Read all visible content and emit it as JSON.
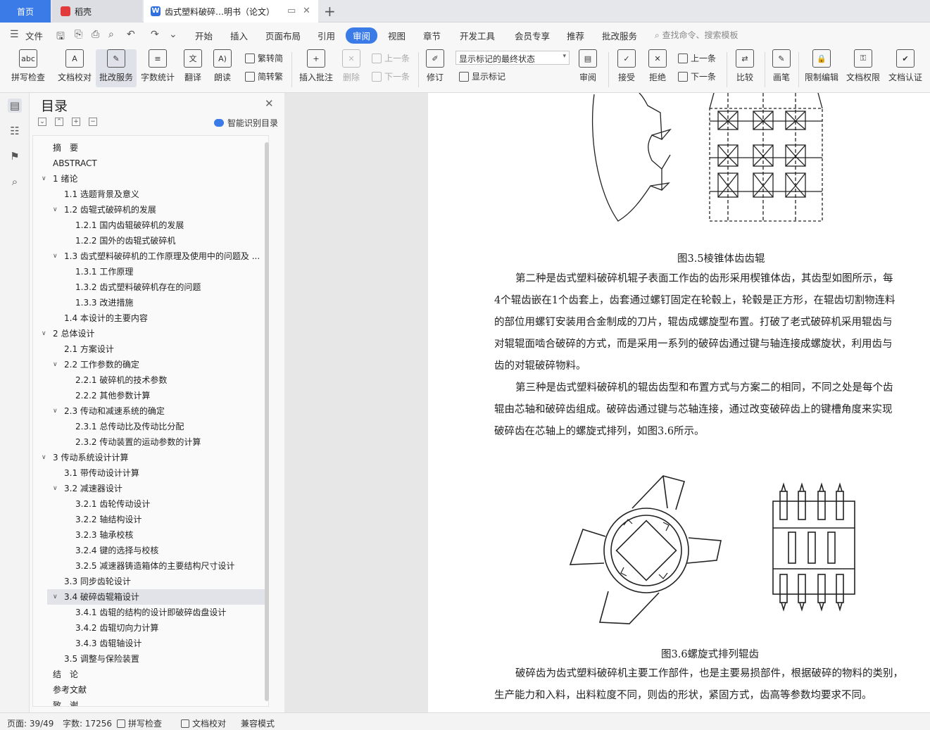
{
  "tabs": {
    "home": "首页",
    "daoke": "稻壳",
    "doc": "齿式塑料破碎…明书（论文）",
    "doc_logo": "W",
    "add": "+"
  },
  "menu": {
    "file": "文件",
    "items": [
      "开始",
      "插入",
      "页面布局",
      "引用",
      "审阅",
      "视图",
      "章节",
      "开发工具",
      "会员专享",
      "推荐",
      "批改服务"
    ],
    "search_placeholder": "查找命令、搜索模板"
  },
  "ribbon": {
    "spellcheck": "拼写检查",
    "doc_proof": "文档校对",
    "correction_service": "批改服务",
    "word_count": "字数统计",
    "translate": "翻译",
    "read_aloud": "朗读",
    "trad_conv": "繁转简",
    "simp_conv": "简转繁",
    "insert_comment": "插入批注",
    "delete": "删除",
    "prev_comment": "上一条",
    "next_comment": "下一条",
    "track_changes": "修订",
    "markup_state": "显示标记的最终状态",
    "show_markup": "显示标记",
    "review": "审阅",
    "accept": "接受",
    "reject": "拒绝",
    "prev_change": "上一条",
    "next_change": "下一条",
    "compare": "比较",
    "pen": "画笔",
    "restrict_edit": "限制编辑",
    "doc_permission": "文档权限",
    "doc_certify": "文档认证"
  },
  "toc": {
    "title": "目录",
    "smart_label": "智能识别目录",
    "items": [
      {
        "text": "摘　要",
        "level": 0,
        "caret": ""
      },
      {
        "text": "ABSTRACT",
        "level": 0,
        "caret": ""
      },
      {
        "text": "1  绪论",
        "level": 0,
        "caret": "v"
      },
      {
        "text": "1.1 选题背景及意义",
        "level": 1,
        "caret": ""
      },
      {
        "text": "1.2 齿辊式破碎机的发展",
        "level": 1,
        "caret": "v"
      },
      {
        "text": "1.2.1 国内齿辊破碎机的发展",
        "level": 2,
        "caret": ""
      },
      {
        "text": "1.2.2 国外的齿辊式破碎机",
        "level": 2,
        "caret": ""
      },
      {
        "text": "1.3 齿式塑料破碎机的工作原理及使用中的问题及 ...",
        "level": 1,
        "caret": "v"
      },
      {
        "text": "1.3.1 工作原理",
        "level": 2,
        "caret": ""
      },
      {
        "text": "1.3.2 齿式塑料破碎机存在的问题",
        "level": 2,
        "caret": ""
      },
      {
        "text": "1.3.3 改进措施",
        "level": 2,
        "caret": ""
      },
      {
        "text": "1.4 本设计的主要内容",
        "level": 1,
        "caret": ""
      },
      {
        "text": "2  总体设计",
        "level": 0,
        "caret": "v"
      },
      {
        "text": "2.1 方案设计",
        "level": 1,
        "caret": ""
      },
      {
        "text": "2.2 工作参数的确定",
        "level": 1,
        "caret": "v"
      },
      {
        "text": "2.2.1 破碎机的技术参数",
        "level": 2,
        "caret": ""
      },
      {
        "text": "2.2.2 其他参数计算",
        "level": 2,
        "caret": ""
      },
      {
        "text": "2.3 传动和减速系统的确定",
        "level": 1,
        "caret": "v"
      },
      {
        "text": "2.3.1 总传动比及传动比分配",
        "level": 2,
        "caret": ""
      },
      {
        "text": "2.3.2 传动装置的运动参数的计算",
        "level": 2,
        "caret": ""
      },
      {
        "text": "3  传动系统设计计算",
        "level": 0,
        "caret": "v"
      },
      {
        "text": "3.1  带传动设计计算",
        "level": 1,
        "caret": ""
      },
      {
        "text": "3.2 减速器设计",
        "level": 1,
        "caret": "v"
      },
      {
        "text": "3.2.1 齿轮传动设计",
        "level": 2,
        "caret": ""
      },
      {
        "text": "3.2.2 轴结构设计",
        "level": 2,
        "caret": ""
      },
      {
        "text": "3.2.3 轴承校核",
        "level": 2,
        "caret": ""
      },
      {
        "text": "3.2.4 键的选择与校核",
        "level": 2,
        "caret": ""
      },
      {
        "text": "3.2.5 减速器铸造箱体的主要结构尺寸设计",
        "level": 2,
        "caret": ""
      },
      {
        "text": "3.3 同步齿轮设计",
        "level": 1,
        "caret": ""
      },
      {
        "text": "3.4 破碎齿辊箱设计",
        "level": 1,
        "caret": "v",
        "selected": true
      },
      {
        "text": "3.4.1 齿辊的结构的设计即破碎齿盘设计",
        "level": 2,
        "caret": ""
      },
      {
        "text": "3.4.2 齿辊切向力计算",
        "level": 2,
        "caret": ""
      },
      {
        "text": "3.4.3 齿辊轴设计",
        "level": 2,
        "caret": ""
      },
      {
        "text": "3.5 调整与保险装置",
        "level": 1,
        "caret": ""
      },
      {
        "text": "结　论",
        "level": 0,
        "caret": ""
      },
      {
        "text": "参考文献",
        "level": 0,
        "caret": ""
      },
      {
        "text": "致　谢",
        "level": 0,
        "caret": ""
      }
    ]
  },
  "document": {
    "fig35_caption": "图3.5棱锥体齿齿辊",
    "para1": [
      "第二种是齿式塑料破碎机辊子表面工作齿的齿形采用楔锥体齿，其齿型如图所示，每",
      "4个辊齿嵌在1个齿套上，齿套通过螺钉固定在轮毂上，轮毂是正方形，在辊齿切割物连料",
      "的部位用螺钉安装用合金制成的刀片，辊齿成螺旋型布置。打破了老式破碎机采用辊齿与",
      "对辊辊面啮合破碎的方式，而是采用一系列的破碎齿通过键与轴连接成螺旋状，利用齿与",
      "齿的对辊破碎物料。"
    ],
    "para2": [
      "第三种是齿式塑料破碎机的辊齿齿型和布置方式与方案二的相同，不同之处是每个齿",
      "辊由芯轴和破碎齿组成。破碎齿通过键与芯轴连接，通过改变破碎齿上的键槽角度来实现",
      "破碎齿在芯轴上的螺旋式排列，如图3.6所示。"
    ],
    "fig36_caption": "图3.6螺旋式排列辊齿",
    "para3": [
      "破碎齿为齿式塑料破碎机主要工作部件，也是主要易损部件，根据破碎的物料的类别，",
      "生产能力和入料，出料粒度不同，则齿的形状，紧固方式，齿高等参数均要求不同。"
    ]
  },
  "status": {
    "page": "页面: 39/49",
    "words": "字数: 17256",
    "spell": "拼写检查",
    "proof": "文档校对",
    "compat": "兼容模式"
  }
}
